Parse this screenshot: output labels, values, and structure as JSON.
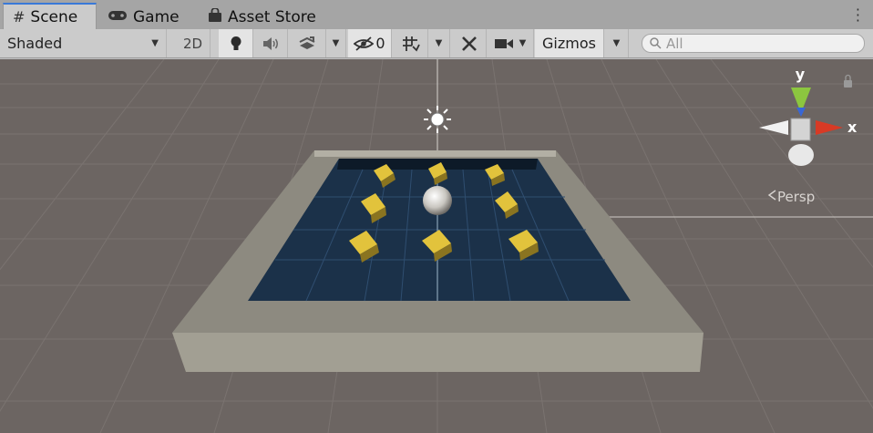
{
  "tabs": [
    {
      "label": "Scene",
      "icon": "hash-grid-icon",
      "active": true
    },
    {
      "label": "Game",
      "icon": "gamepad-icon",
      "active": false
    },
    {
      "label": "Asset Store",
      "icon": "shopping-bag-icon",
      "active": false
    }
  ],
  "toolbar": {
    "draw_mode": "Shaded",
    "mode_2d": "2D",
    "hidden_count": "0",
    "gizmos": "Gizmos",
    "search_placeholder": "All",
    "lighting_on": true
  },
  "gizmo": {
    "y_label": "y",
    "x_label": "x",
    "projection": "Persp"
  },
  "colors": {
    "scene_bg": "#6c6562",
    "floor": "#1b3149",
    "wall": "#a29f93",
    "pickup": "#e2c33c",
    "axis_x": "#d83a25",
    "axis_y": "#8cc63f",
    "axis_z": "#3867d6"
  },
  "scene_objects": [
    "directional-light",
    "player-sphere",
    "pickup-cube x9",
    "arena-walls",
    "ground-floor"
  ]
}
